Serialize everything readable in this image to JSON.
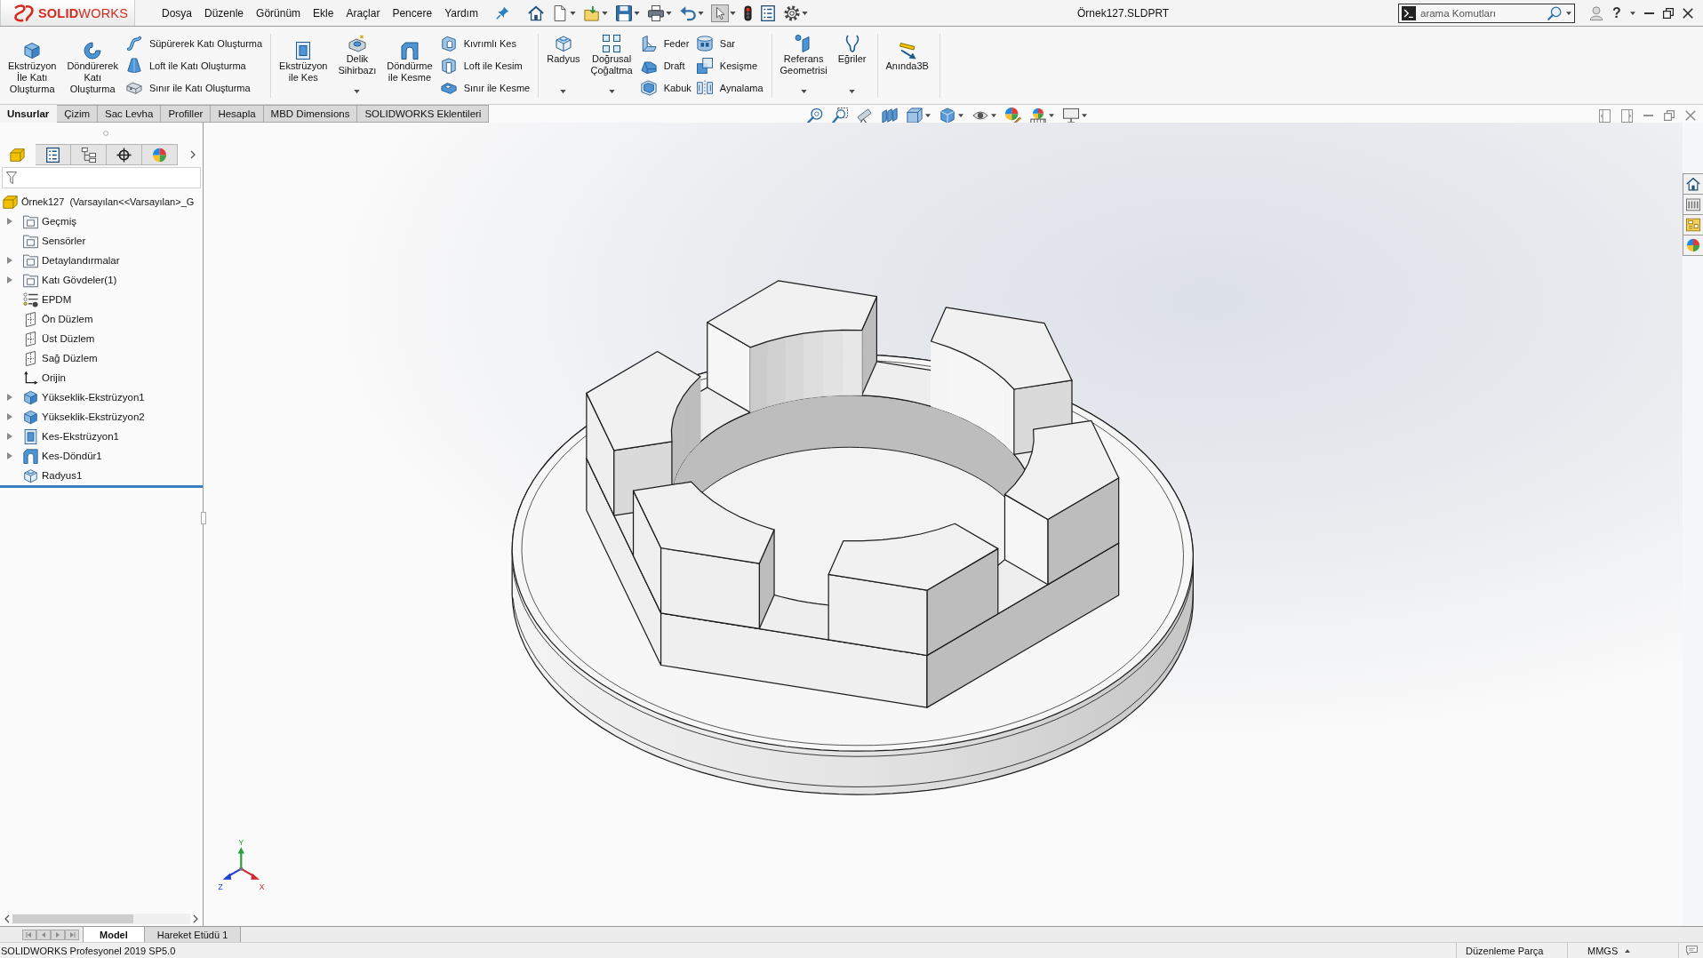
{
  "title_bar": {
    "logo": "**SOLID**WORKS",
    "menu": [
      "Dosya",
      "Düzenle",
      "Görünüm",
      "Ekle",
      "Araçlar",
      "Pencere",
      "Yardım"
    ],
    "quick_access": [
      {
        "dropdown": false,
        "active": false
      },
      {
        "dropdown": true,
        "active": false
      },
      {
        "dropdown": true,
        "active": false
      },
      {
        "dropdown": true,
        "active": false
      },
      {
        "dropdown": true,
        "active": false
      },
      {
        "dropdown": true,
        "active": false
      },
      {
        "dropdown": true,
        "active": true
      },
      {
        "dropdown": false,
        "active": false
      },
      {
        "dropdown": false,
        "active": false
      },
      {
        "dropdown": true,
        "active": false
      }
    ],
    "document_title": "Örnek127.SLDPRT",
    "search": {
      "placeholder": "arama Komutları"
    },
    "help": "?"
  },
  "command_manager": {
    "groups": [
      {
        "items": [
          {
            "kind": "large",
            "label": "Ekstrüzyon\nİle Katı\nOluşturma",
            "dropdown": false
          },
          {
            "kind": "large",
            "label": "Döndürerek\nKatı\nOluşturma",
            "dropdown": false
          },
          {
            "kind": "stack",
            "items": [
              "Süpürerek Katı Oluşturma",
              "Loft ile Katı Oluşturma",
              "Sınır ile Katı Oluşturma"
            ]
          }
        ]
      },
      {
        "items": [
          {
            "kind": "large",
            "label": "Ekstrüzyon\nile Kes",
            "dropdown": false
          },
          {
            "kind": "large",
            "label": "Delik\nSihirbazı",
            "dropdown": true
          },
          {
            "kind": "large",
            "label": "Döndürme\nile Kesme",
            "dropdown": false
          },
          {
            "kind": "stack",
            "items": [
              "Kıvrımlı Kes",
              "Loft ile Kesim",
              "Sınır ile Kesme"
            ]
          }
        ]
      },
      {
        "items": [
          {
            "kind": "large",
            "label": "Radyus",
            "dropdown": true
          },
          {
            "kind": "large",
            "label": "Doğrusal\nÇoğaltma",
            "dropdown": true
          },
          {
            "kind": "stack",
            "items": [
              "Feder",
              "Draft",
              "Kabuk"
            ]
          },
          {
            "kind": "stack",
            "items": [
              "Sar",
              "Kesişme",
              "Aynalama"
            ]
          }
        ]
      },
      {
        "items": [
          {
            "kind": "large",
            "label": "Referans\nGeometrisi",
            "dropdown": true
          },
          {
            "kind": "large",
            "label": "Eğriler",
            "dropdown": true
          }
        ]
      },
      {
        "items": [
          {
            "kind": "large",
            "label": "Anında3B",
            "dropdown": false
          }
        ]
      }
    ]
  },
  "tabs": [
    {
      "label": "Unsurlar",
      "selected": true
    },
    {
      "label": "Çizim",
      "selected": false
    },
    {
      "label": "Sac Levha",
      "selected": false
    },
    {
      "label": "Profiller",
      "selected": false
    },
    {
      "label": "Hesapla",
      "selected": false
    },
    {
      "label": "MBD Dimensions",
      "selected": false
    },
    {
      "label": "SOLIDWORKS Eklentileri",
      "selected": false
    }
  ],
  "view_toolbar": [
    {
      "dropdown": false
    },
    {
      "dropdown": false
    },
    {
      "dropdown": false
    },
    {
      "dropdown": false
    },
    {
      "dropdown": true
    },
    {
      "dropdown": true
    },
    {
      "dropdown": true
    },
    {
      "dropdown": false
    },
    {
      "dropdown": true
    },
    {
      "dropdown": true
    }
  ],
  "feature_manager": {
    "panel_tabs": [
      {
        "selected": true
      },
      {
        "selected": false
      },
      {
        "selected": false
      },
      {
        "selected": false
      },
      {
        "selected": false
      }
    ],
    "tree": {
      "kind": "part",
      "label": "Örnek127  (Varsayılan<<Varsayılan>_G",
      "children": [
        {
          "kind": "folder",
          "label": "Geçmiş",
          "expander": true
        },
        {
          "kind": "folder",
          "label": "Sensörler",
          "expander": false
        },
        {
          "kind": "folder",
          "label": "Detaylandırmalar",
          "expander": true
        },
        {
          "kind": "folder",
          "label": "Katı Gövdeler(1)",
          "expander": true
        },
        {
          "kind": "list",
          "label": "EPDM",
          "expander": false
        },
        {
          "kind": "plane",
          "label": "Ön Düzlem",
          "expander": false
        },
        {
          "kind": "plane",
          "label": "Üst Düzlem",
          "expander": false
        },
        {
          "kind": "plane",
          "label": "Sağ Düzlem",
          "expander": false
        },
        {
          "kind": "origin",
          "label": "Orijin",
          "expander": false
        },
        {
          "kind": "extrude",
          "label": "Yükseklik-Ekstrüzyon1",
          "expander": true
        },
        {
          "kind": "extrude",
          "label": "Yükseklik-Ekstrüzyon2",
          "expander": true
        },
        {
          "kind": "cut",
          "label": "Kes-Ekstrüzyon1",
          "expander": true
        },
        {
          "kind": "revolve_cut",
          "label": "Kes-Döndür1",
          "expander": true
        },
        {
          "kind": "fillet",
          "label": "Radyus1",
          "expander": false
        }
      ]
    }
  },
  "viewport": {
    "axis_labels": [
      "Y",
      "Z",
      "X"
    ]
  },
  "bottom_tabs": [
    {
      "label": "Model",
      "selected": true
    },
    {
      "label": "Hareket Etüdü 1",
      "selected": false
    }
  ],
  "status_bar": {
    "product": "SOLIDWORKS Profesyonel 2019 SP5.0",
    "mode": "Düzenleme Parça",
    "units": "MMGS"
  }
}
